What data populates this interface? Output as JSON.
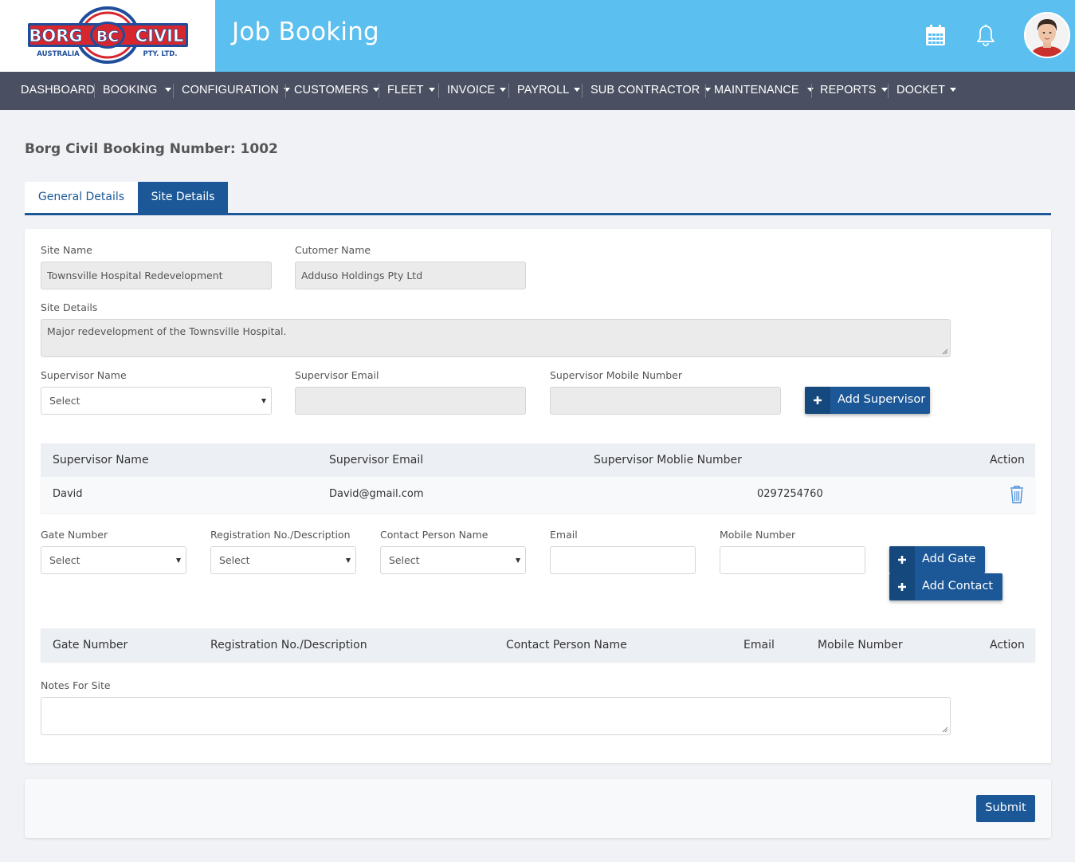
{
  "header": {
    "logo": {
      "left_word": "BORG",
      "mid_word": "BC",
      "right_word": "CIVIL",
      "sub_left": "AUSTRALIA",
      "sub_right": "PTY. LTD."
    },
    "title": "Job Booking",
    "icons": [
      "calendar-icon",
      "bell-icon"
    ]
  },
  "nav": {
    "items": [
      {
        "label": "DASHBOARD",
        "caret": false
      },
      {
        "label": "BOOKING",
        "caret": true
      },
      {
        "label": "CONFIGURATION",
        "caret": true
      },
      {
        "label": "CUSTOMERS",
        "caret": true
      },
      {
        "label": "FLEET",
        "caret": true
      },
      {
        "label": "INVOICE",
        "caret": true
      },
      {
        "label": "PAYROLL",
        "caret": true
      },
      {
        "label": "SUB CONTRACTOR",
        "caret": true
      },
      {
        "label": "MAINTENANCE",
        "caret": true
      },
      {
        "label": "REPORTS",
        "caret": true
      },
      {
        "label": "DOCKET",
        "caret": true
      }
    ]
  },
  "page": {
    "title": "Borg Civil Booking Number: 1002",
    "tabs": [
      {
        "label": "General Details",
        "active": false
      },
      {
        "label": "Site Details",
        "active": true
      }
    ]
  },
  "form": {
    "site_name": {
      "label": "Site Name",
      "value": "Townsville Hospital Redevelopment"
    },
    "customer_name": {
      "label": "Cutomer Name",
      "value": "Adduso Holdings Pty Ltd"
    },
    "site_details": {
      "label": "Site Details",
      "value": "Major redevelopment of the Townsville Hospital."
    },
    "supervisor_name": {
      "label": "Supervisor Name",
      "value": "Select"
    },
    "supervisor_email": {
      "label": "Supervisor Email",
      "value": ""
    },
    "supervisor_mobile": {
      "label": "Supervisor Mobile Number",
      "value": ""
    },
    "add_supervisor": "Add Supervisor",
    "gate_number": {
      "label": "Gate Number",
      "value": "Select"
    },
    "registration": {
      "label": "Registration No./Description",
      "value": "Select"
    },
    "contact_person": {
      "label": "Contact Person Name",
      "value": "Select"
    },
    "email": {
      "label": "Email",
      "value": ""
    },
    "mobile": {
      "label": "Mobile Number",
      "value": ""
    },
    "add_gate": "Add Gate",
    "add_contact": "Add Contact",
    "notes": {
      "label": "Notes For Site",
      "value": ""
    }
  },
  "supervisor_table": {
    "headers": [
      "Supervisor Name",
      "Supervisor Email",
      "Supervisor Moblie Number",
      "Action"
    ],
    "rows": [
      {
        "name": "David",
        "email": "David@gmail.com",
        "mobile": "0297254760",
        "action_icon": "trash-icon"
      }
    ]
  },
  "gate_table": {
    "headers": [
      "Gate Number",
      "Registration No./Description",
      "Contact Person Name",
      "Email",
      "Mobile Number",
      "Action"
    ],
    "rows": []
  },
  "footer": {
    "submit": "Submit"
  },
  "colors": {
    "header_bg": "#5bbfef",
    "nav_bg": "#4a5061",
    "primary": "#1c5897",
    "logo_red": "#d8262e",
    "logo_blue": "#1f4d9b"
  }
}
